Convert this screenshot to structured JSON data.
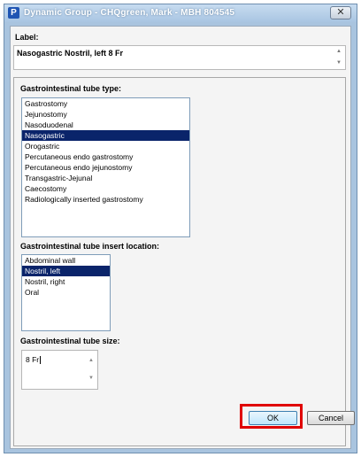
{
  "window": {
    "app_icon_letter": "P",
    "title": "Dynamic Group - CHQgreen, Mark - MBH 804545",
    "close_glyph": "✕"
  },
  "label_field": {
    "label": "Label:",
    "value": "Nasogastric Nostril, left 8 Fr"
  },
  "tube_type": {
    "label": "Gastrointestinal tube type:",
    "items": [
      "Gastrostomy",
      "Jejunostomy",
      "Nasoduodenal",
      "Nasogastric",
      "Orogastric",
      "Percutaneous endo gastrostomy",
      "Percutaneous endo jejunostomy",
      "Transgastric-Jejunal",
      "Caecostomy",
      "Radiologically inserted gastrostomy"
    ],
    "selected": "Nasogastric"
  },
  "insert_location": {
    "label": "Gastrointestinal tube insert location:",
    "items": [
      "Abdominal wall",
      "Nostril, left",
      "Nostril, right",
      "Oral"
    ],
    "selected": "Nostril, left"
  },
  "tube_size": {
    "label": "Gastrointestinal tube size:",
    "value": "8 Fr"
  },
  "buttons": {
    "ok": "OK",
    "cancel": "Cancel"
  },
  "colors": {
    "selection": "#0a246a",
    "highlight": "#e00000",
    "titlebar": "#a9c5e2"
  }
}
